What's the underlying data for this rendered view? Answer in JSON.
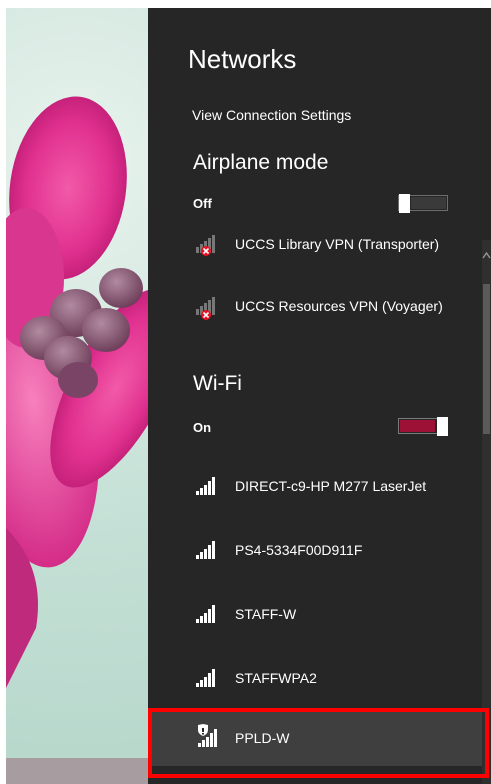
{
  "colors": {
    "panel_bg": "#262626",
    "accent": "#9e1137",
    "toggle_off": "#3a3a3a",
    "highlight": "#ff0000",
    "error_badge": "#e81123"
  },
  "panel": {
    "title": "Networks",
    "view_connection_settings": "View Connection Settings"
  },
  "airplane": {
    "heading": "Airplane mode",
    "state": "Off",
    "on": false
  },
  "vpn": {
    "items": [
      {
        "label": "UCCS Library VPN (Transporter)",
        "icon": "vpn-disconnected-icon"
      },
      {
        "label": "UCCS Resources VPN (Voyager)",
        "icon": "vpn-disconnected-icon"
      }
    ]
  },
  "wifi": {
    "heading": "Wi-Fi",
    "state": "On",
    "on": true,
    "networks": [
      {
        "label": "DIRECT-c9-HP M277 LaserJet",
        "icon": "wifi-signal-icon"
      },
      {
        "label": "PS4-5334F00D911F",
        "icon": "wifi-signal-icon"
      },
      {
        "label": "STAFF-W",
        "icon": "wifi-signal-icon"
      },
      {
        "label": "STAFFWPA2",
        "icon": "wifi-signal-icon"
      },
      {
        "label": "PPLD-W",
        "icon": "wifi-shield-icon",
        "selected": true
      }
    ]
  }
}
